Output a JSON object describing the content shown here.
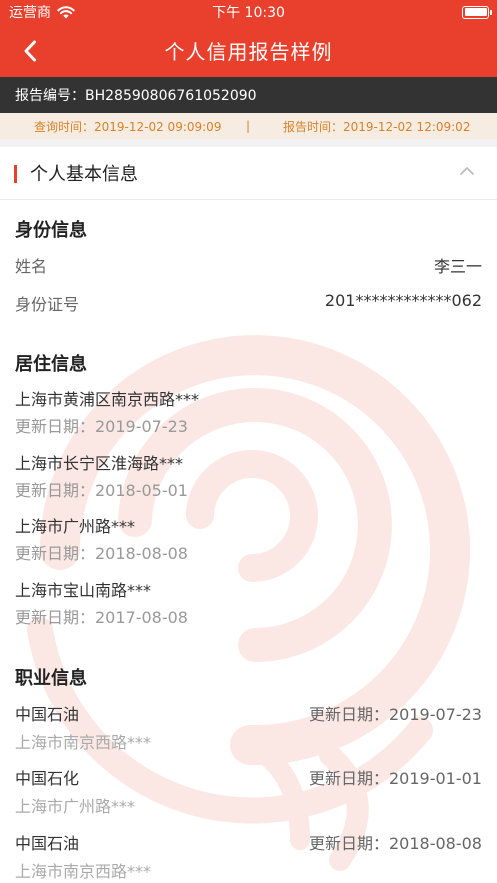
{
  "status_bar": {
    "carrier": "运营商",
    "time": "下午 10:30",
    "icons": [
      "wifi-icon",
      "battery-icon"
    ]
  },
  "nav": {
    "back_icon": "chevron-left-icon",
    "title": "个人信用报告样例"
  },
  "report": {
    "number": "报告编号：BH28590806761052090",
    "query_time": "查询时间：2019-12-02 09:09:09",
    "separator": "|",
    "report_time": "报告时间：2019-12-02 12:09:02"
  },
  "section": {
    "title": "个人基本信息",
    "collapse_icon": "chevron-up-icon"
  },
  "identity": {
    "heading": "身份信息",
    "name_label": "姓名",
    "name_value": "李三一",
    "id_label": "身份证号",
    "id_value": "201************062"
  },
  "residence": {
    "heading": "居住信息",
    "items": [
      {
        "address": "上海市黄浦区南京西路***",
        "date": "更新日期：2019-07-23"
      },
      {
        "address": "上海市长宁区淮海路***",
        "date": "更新日期：2018-05-01"
      },
      {
        "address": "上海市广州路***",
        "date": "更新日期：2018-08-08"
      },
      {
        "address": "上海市宝山南路***",
        "date": "更新日期：2017-08-08"
      }
    ]
  },
  "occupation": {
    "heading": "职业信息",
    "items": [
      {
        "company": "中国石油",
        "date": "更新日期：2019-07-23",
        "address": "上海市南京西路***"
      },
      {
        "company": "中国石化",
        "date": "更新日期：2019-01-01",
        "address": "上海市广州路***"
      },
      {
        "company": "中国石油",
        "date": "更新日期：2018-08-08",
        "address": "上海市南京西路***"
      }
    ]
  },
  "colors": {
    "brand_red": "#e8402d",
    "dark_bar": "#333333",
    "time_bar_bg": "#f7ece1",
    "time_bar_text": "#d8822a"
  }
}
